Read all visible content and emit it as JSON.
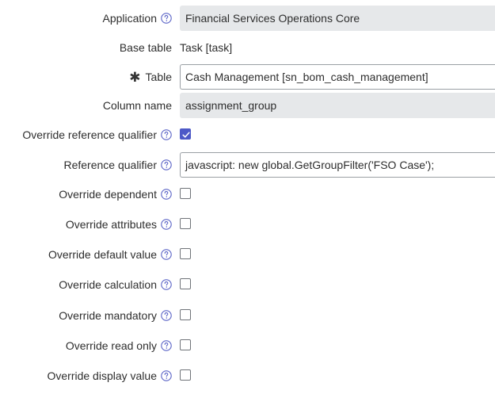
{
  "colors": {
    "accent": "#4d59c7",
    "readonly_bg": "#e6e8ea",
    "text": "#2e2e2e",
    "help_icon": "#5a63c6"
  },
  "fields": {
    "application": {
      "label": "Application",
      "value": "Financial Services Operations Core"
    },
    "base_table": {
      "label": "Base table",
      "value": "Task [task]"
    },
    "table": {
      "label": "Table",
      "mandatory_mark": "✱",
      "value": "Cash Management [sn_bom_cash_management]"
    },
    "column_name": {
      "label": "Column name",
      "value": "assignment_group"
    },
    "override_reference_qualifier": {
      "label": "Override reference qualifier",
      "checked": true
    },
    "reference_qualifier": {
      "label": "Reference qualifier",
      "value": "javascript: new global.GetGroupFilter('FSO Case');"
    },
    "override_dependent": {
      "label": "Override dependent",
      "checked": false
    },
    "override_attributes": {
      "label": "Override attributes",
      "checked": false
    },
    "override_default_value": {
      "label": "Override default value",
      "checked": false
    },
    "override_calculation": {
      "label": "Override calculation",
      "checked": false
    },
    "override_mandatory": {
      "label": "Override mandatory",
      "checked": false
    },
    "override_read_only": {
      "label": "Override read only",
      "checked": false
    },
    "override_display_value": {
      "label": "Override display value",
      "checked": false
    }
  },
  "icons": {
    "help": "help-circle-icon",
    "check": "check-icon"
  }
}
